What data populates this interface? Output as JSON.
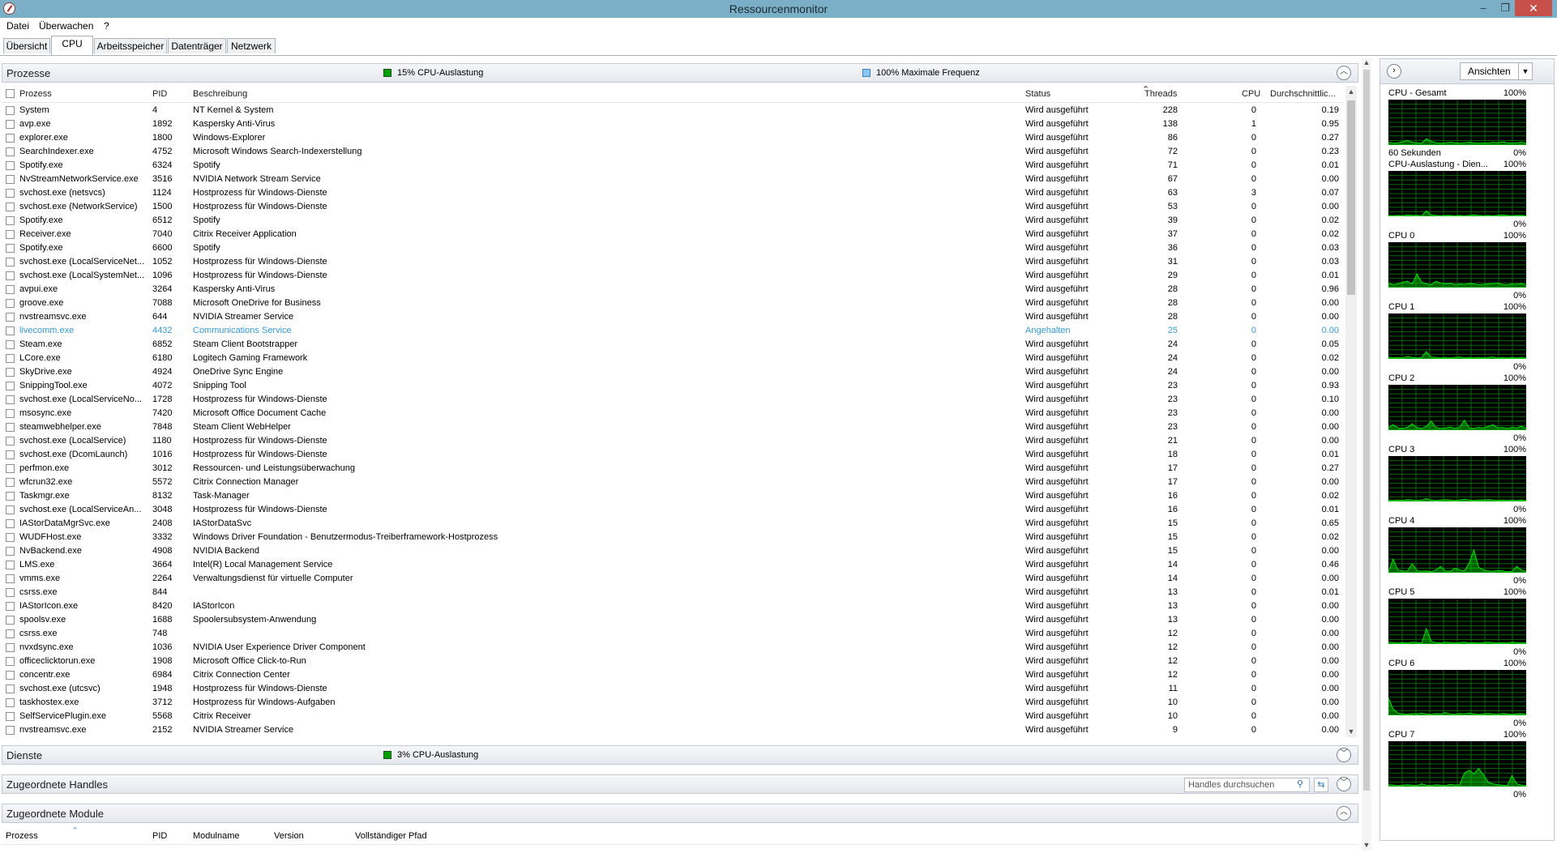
{
  "window": {
    "title": "Ressourcenmonitor",
    "minimize": "–",
    "maximize": "❐",
    "close": "✕"
  },
  "menu": [
    "Datei",
    "Überwachen",
    "?"
  ],
  "tabs": [
    "Übersicht",
    "CPU",
    "Arbeitsspeicher",
    "Datenträger",
    "Netzwerk"
  ],
  "active_tab": "CPU",
  "colors": {
    "cpu_usage": "#00a000",
    "max_frequency": "#5aa0e6",
    "graph_bg": "#000000",
    "graph_grid": "#0a6a0a",
    "graph_line": "#00e000"
  },
  "processes": {
    "title": "Prozesse",
    "cpu_usage_label": "15% CPU-Auslastung",
    "max_freq_label": "100% Maximale Frequenz",
    "columns": {
      "process": "Prozess",
      "pid": "PID",
      "description": "Beschreibung",
      "status": "Status",
      "threads": "Threads",
      "cpu": "CPU",
      "avg": "Durchschnittlic..."
    },
    "rows": [
      [
        "System",
        "4",
        "NT Kernel & System",
        "Wird ausgeführt",
        "228",
        "0",
        "0.19"
      ],
      [
        "avp.exe",
        "1892",
        "Kaspersky Anti-Virus",
        "Wird ausgeführt",
        "138",
        "1",
        "0.95"
      ],
      [
        "explorer.exe",
        "1800",
        "Windows-Explorer",
        "Wird ausgeführt",
        "86",
        "0",
        "0.27"
      ],
      [
        "SearchIndexer.exe",
        "4752",
        "Microsoft Windows Search-Indexerstellung",
        "Wird ausgeführt",
        "72",
        "0",
        "0.23"
      ],
      [
        "Spotify.exe",
        "6324",
        "Spotify",
        "Wird ausgeführt",
        "71",
        "0",
        "0.01"
      ],
      [
        "NvStreamNetworkService.exe",
        "3516",
        "NVIDIA Network Stream Service",
        "Wird ausgeführt",
        "67",
        "0",
        "0.00"
      ],
      [
        "svchost.exe (netsvcs)",
        "1124",
        "Hostprozess für Windows-Dienste",
        "Wird ausgeführt",
        "63",
        "3",
        "0.07"
      ],
      [
        "svchost.exe (NetworkService)",
        "1500",
        "Hostprozess für Windows-Dienste",
        "Wird ausgeführt",
        "53",
        "0",
        "0.00"
      ],
      [
        "Spotify.exe",
        "6512",
        "Spotify",
        "Wird ausgeführt",
        "39",
        "0",
        "0.02"
      ],
      [
        "Receiver.exe",
        "7040",
        "Citrix Receiver Application",
        "Wird ausgeführt",
        "37",
        "0",
        "0.02"
      ],
      [
        "Spotify.exe",
        "6600",
        "Spotify",
        "Wird ausgeführt",
        "36",
        "0",
        "0.03"
      ],
      [
        "svchost.exe (LocalServiceNet...",
        "1052",
        "Hostprozess für Windows-Dienste",
        "Wird ausgeführt",
        "31",
        "0",
        "0.03"
      ],
      [
        "svchost.exe (LocalSystemNet...",
        "1096",
        "Hostprozess für Windows-Dienste",
        "Wird ausgeführt",
        "29",
        "0",
        "0.01"
      ],
      [
        "avpui.exe",
        "3264",
        "Kaspersky Anti-Virus",
        "Wird ausgeführt",
        "28",
        "0",
        "0.96"
      ],
      [
        "groove.exe",
        "7088",
        "Microsoft OneDrive for Business",
        "Wird ausgeführt",
        "28",
        "0",
        "0.00"
      ],
      [
        "nvstreamsvc.exe",
        "644",
        "NVIDIA Streamer Service",
        "Wird ausgeführt",
        "28",
        "0",
        "0.00"
      ],
      [
        "livecomm.exe",
        "4432",
        "Communications Service",
        "Angehalten",
        "25",
        "0",
        "0.00"
      ],
      [
        "Steam.exe",
        "6852",
        "Steam Client Bootstrapper",
        "Wird ausgeführt",
        "24",
        "0",
        "0.05"
      ],
      [
        "LCore.exe",
        "6180",
        "Logitech Gaming Framework",
        "Wird ausgeführt",
        "24",
        "0",
        "0.02"
      ],
      [
        "SkyDrive.exe",
        "4924",
        "OneDrive Sync Engine",
        "Wird ausgeführt",
        "24",
        "0",
        "0.00"
      ],
      [
        "SnippingTool.exe",
        "4072",
        "Snipping Tool",
        "Wird ausgeführt",
        "23",
        "0",
        "0.93"
      ],
      [
        "svchost.exe (LocalServiceNo...",
        "1728",
        "Hostprozess für Windows-Dienste",
        "Wird ausgeführt",
        "23",
        "0",
        "0.10"
      ],
      [
        "msosync.exe",
        "7420",
        "Microsoft Office Document Cache",
        "Wird ausgeführt",
        "23",
        "0",
        "0.00"
      ],
      [
        "steamwebhelper.exe",
        "7848",
        "Steam Client WebHelper",
        "Wird ausgeführt",
        "23",
        "0",
        "0.00"
      ],
      [
        "svchost.exe (LocalService)",
        "1180",
        "Hostprozess für Windows-Dienste",
        "Wird ausgeführt",
        "21",
        "0",
        "0.00"
      ],
      [
        "svchost.exe (DcomLaunch)",
        "1016",
        "Hostprozess für Windows-Dienste",
        "Wird ausgeführt",
        "18",
        "0",
        "0.01"
      ],
      [
        "perfmon.exe",
        "3012",
        "Ressourcen- und Leistungsüberwachung",
        "Wird ausgeführt",
        "17",
        "0",
        "0.27"
      ],
      [
        "wfcrun32.exe",
        "5572",
        "Citrix Connection Manager",
        "Wird ausgeführt",
        "17",
        "0",
        "0.00"
      ],
      [
        "Taskmgr.exe",
        "8132",
        "Task-Manager",
        "Wird ausgeführt",
        "16",
        "0",
        "0.02"
      ],
      [
        "svchost.exe (LocalServiceAn...",
        "3048",
        "Hostprozess für Windows-Dienste",
        "Wird ausgeführt",
        "16",
        "0",
        "0.01"
      ],
      [
        "IAStorDataMgrSvc.exe",
        "2408",
        "IAStorDataSvc",
        "Wird ausgeführt",
        "15",
        "0",
        "0.65"
      ],
      [
        "WUDFHost.exe",
        "3332",
        "Windows Driver Foundation - Benutzermodus-Treiberframework-Hostprozess",
        "Wird ausgeführt",
        "15",
        "0",
        "0.02"
      ],
      [
        "NvBackend.exe",
        "4908",
        "NVIDIA Backend",
        "Wird ausgeführt",
        "15",
        "0",
        "0.00"
      ],
      [
        "LMS.exe",
        "3664",
        "Intel(R) Local Management Service",
        "Wird ausgeführt",
        "14",
        "0",
        "0.46"
      ],
      [
        "vmms.exe",
        "2264",
        "Verwaltungsdienst für virtuelle Computer",
        "Wird ausgeführt",
        "14",
        "0",
        "0.00"
      ],
      [
        "csrss.exe",
        "844",
        "",
        "Wird ausgeführt",
        "13",
        "0",
        "0.01"
      ],
      [
        "IAStorIcon.exe",
        "8420",
        "IAStorIcon",
        "Wird ausgeführt",
        "13",
        "0",
        "0.00"
      ],
      [
        "spoolsv.exe",
        "1688",
        "Spoolersubsystem-Anwendung",
        "Wird ausgeführt",
        "13",
        "0",
        "0.00"
      ],
      [
        "csrss.exe",
        "748",
        "",
        "Wird ausgeführt",
        "12",
        "0",
        "0.00"
      ],
      [
        "nvxdsync.exe",
        "1036",
        "NVIDIA User Experience Driver Component",
        "Wird ausgeführt",
        "12",
        "0",
        "0.00"
      ],
      [
        "officeclicktorun.exe",
        "1908",
        "Microsoft Office Click-to-Run",
        "Wird ausgeführt",
        "12",
        "0",
        "0.00"
      ],
      [
        "concentr.exe",
        "6984",
        "Citrix Connection Center",
        "Wird ausgeführt",
        "12",
        "0",
        "0.00"
      ],
      [
        "svchost.exe (utcsvc)",
        "1948",
        "Hostprozess für Windows-Dienste",
        "Wird ausgeführt",
        "11",
        "0",
        "0.00"
      ],
      [
        "taskhostex.exe",
        "3712",
        "Hostprozess für Windows-Aufgaben",
        "Wird ausgeführt",
        "10",
        "0",
        "0.00"
      ],
      [
        "SelfServicePlugin.exe",
        "5568",
        "Citrix Receiver",
        "Wird ausgeführt",
        "10",
        "0",
        "0.00"
      ],
      [
        "nvstreamsvc.exe",
        "2152",
        "NVIDIA Streamer Service",
        "Wird ausgeführt",
        "9",
        "0",
        "0.00"
      ]
    ]
  },
  "services": {
    "title": "Dienste",
    "cpu_usage_label": "3% CPU-Auslastung"
  },
  "handles": {
    "title": "Zugeordnete Handles",
    "search_placeholder": "Handles durchsuchen"
  },
  "modules": {
    "title": "Zugeordnete Module",
    "columns": {
      "process": "Prozess",
      "pid": "PID",
      "module": "Modulname",
      "version": "Version",
      "path": "Vollständiger Pfad"
    }
  },
  "graphs": {
    "views_label": "Ansichten",
    "items": [
      {
        "title": "CPU - Gesamt",
        "max": "100%",
        "min": "0%",
        "sub": "60 Sekunden",
        "values": [
          6,
          4,
          5,
          7,
          10,
          6,
          5,
          4,
          14,
          8,
          5,
          4,
          5,
          6,
          5,
          4,
          5,
          6,
          5,
          4,
          5,
          4,
          6,
          5,
          7,
          5,
          4,
          5,
          6,
          4
        ]
      },
      {
        "title": "CPU-Auslastung - Dien...",
        "max": "100%",
        "min": "0%",
        "sub": "",
        "values": [
          2,
          1,
          2,
          1,
          3,
          2,
          2,
          1,
          12,
          3,
          2,
          1,
          2,
          2,
          1,
          2,
          1,
          2,
          3,
          2,
          1,
          2,
          1,
          2,
          3,
          2,
          1,
          2,
          2,
          1
        ]
      },
      {
        "title": "CPU 0",
        "max": "100%",
        "min": "0%",
        "sub": "",
        "values": [
          10,
          6,
          8,
          12,
          14,
          8,
          30,
          12,
          8,
          6,
          14,
          10,
          8,
          10,
          6,
          8,
          7,
          9,
          8,
          6,
          7,
          8,
          9,
          10,
          7,
          6,
          8,
          7,
          9,
          6
        ]
      },
      {
        "title": "CPU 1",
        "max": "100%",
        "min": "0%",
        "sub": "",
        "values": [
          4,
          2,
          3,
          2,
          5,
          3,
          2,
          3,
          16,
          4,
          3,
          2,
          3,
          2,
          3,
          4,
          2,
          3,
          2,
          3,
          2,
          3,
          4,
          2,
          3,
          2,
          3,
          2,
          3,
          2
        ]
      },
      {
        "title": "CPU 2",
        "max": "100%",
        "min": "0%",
        "sub": "",
        "values": [
          6,
          12,
          5,
          4,
          6,
          14,
          6,
          4,
          8,
          20,
          6,
          4,
          5,
          7,
          4,
          6,
          22,
          5,
          4,
          6,
          5,
          8,
          12,
          5,
          6,
          4,
          6,
          5,
          9,
          4
        ]
      },
      {
        "title": "CPU 3",
        "max": "100%",
        "min": "0%",
        "sub": "",
        "values": [
          3,
          2,
          3,
          2,
          4,
          3,
          2,
          3,
          6,
          3,
          2,
          3,
          4,
          3,
          2,
          3,
          5,
          3,
          2,
          3,
          3,
          4,
          3,
          2,
          3,
          2,
          3,
          2,
          3,
          2
        ]
      },
      {
        "title": "CPU 4",
        "max": "100%",
        "min": "0%",
        "sub": "",
        "values": [
          2,
          30,
          6,
          4,
          3,
          20,
          5,
          3,
          4,
          2,
          6,
          14,
          4,
          3,
          10,
          6,
          4,
          22,
          50,
          12,
          6,
          4,
          3,
          5,
          4,
          2,
          3,
          14,
          6,
          3
        ]
      },
      {
        "title": "CPU 5",
        "max": "100%",
        "min": "0%",
        "sub": "",
        "values": [
          4,
          3,
          2,
          3,
          2,
          4,
          3,
          2,
          34,
          6,
          3,
          2,
          4,
          3,
          2,
          3,
          4,
          2,
          3,
          2,
          3,
          4,
          3,
          2,
          3,
          2,
          4,
          3,
          2,
          3
        ]
      },
      {
        "title": "CPU 6",
        "max": "100%",
        "min": "0%",
        "sub": "",
        "values": [
          38,
          14,
          5,
          3,
          2,
          4,
          3,
          5,
          3,
          2,
          4,
          3,
          6,
          3,
          2,
          4,
          3,
          5,
          3,
          2,
          3,
          4,
          3,
          2,
          4,
          3,
          2,
          3,
          4,
          2
        ]
      },
      {
        "title": "CPU 7",
        "max": "100%",
        "min": "0%",
        "sub": "",
        "values": [
          4,
          3,
          2,
          3,
          4,
          3,
          2,
          6,
          3,
          2,
          4,
          3,
          2,
          5,
          3,
          4,
          30,
          36,
          28,
          40,
          26,
          10,
          6,
          4,
          3,
          2,
          24,
          6,
          3,
          2
        ]
      }
    ]
  }
}
